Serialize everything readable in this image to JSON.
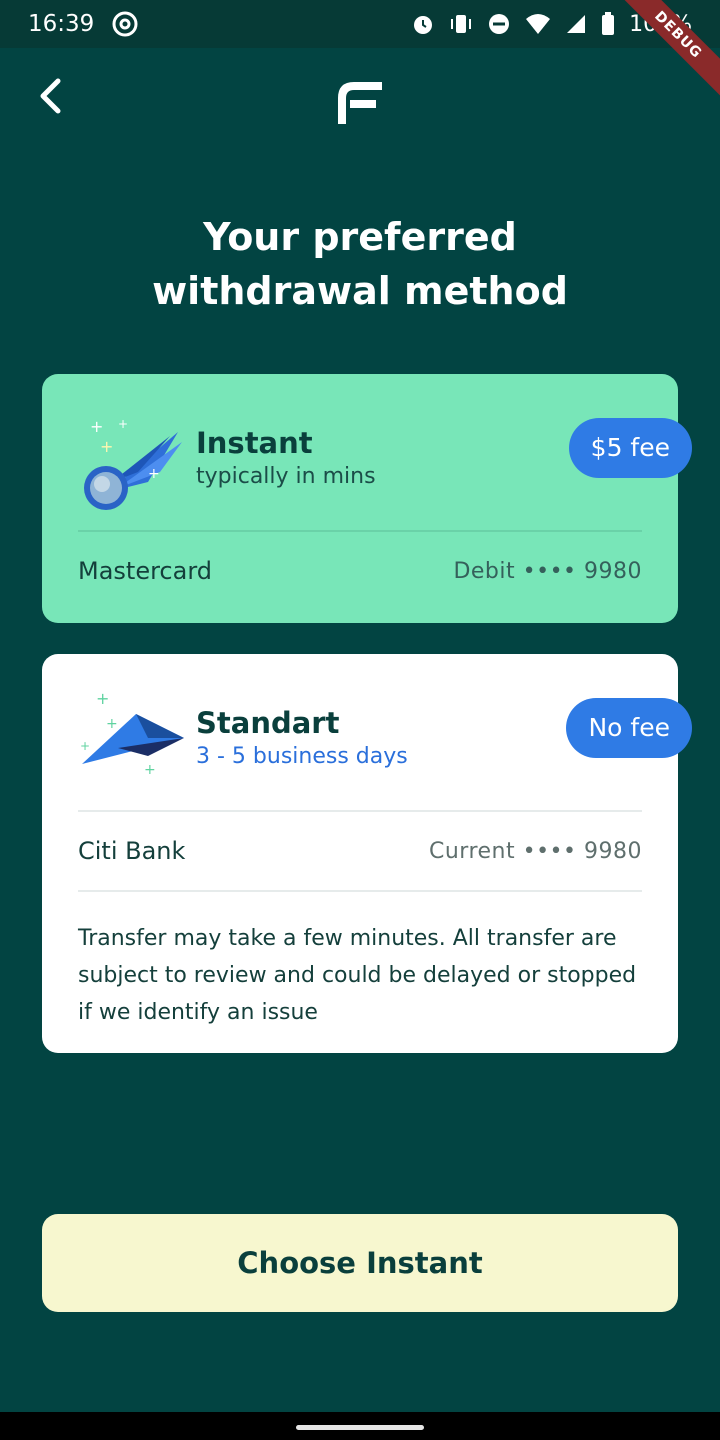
{
  "status_bar": {
    "time": "16:39",
    "battery": "100%",
    "debug_banner": "DEBUG",
    "icons": [
      "at-sign-icon",
      "alarm-icon",
      "vibrate-icon",
      "dnd-icon",
      "wifi-icon",
      "signal-icon",
      "battery-icon"
    ]
  },
  "header": {
    "back_icon": "chevron-left-icon",
    "logo_icon": "f-logo-icon"
  },
  "title": {
    "line1": "Your preferred",
    "line2": "withdrawal method"
  },
  "methods": [
    {
      "name": "Instant",
      "subtitle": "typically in mins",
      "fee": "$5 fee",
      "account_name": "Mastercard",
      "account_detail": "Debit •••• 9980",
      "icon": "meteor-icon",
      "colors": {
        "card": "#78e6b8"
      }
    },
    {
      "name": "Standart",
      "subtitle": "3 - 5 business days",
      "fee": "No fee",
      "account_name": "Citi Bank",
      "account_detail": "Current •••• 9980",
      "icon": "paper-plane-icon",
      "note": "Transfer may take a few minutes. All transfer are subject to review and could be delayed or stopped if we identify an issue",
      "colors": {
        "card": "#ffffff"
      }
    }
  ],
  "cta": {
    "label": "Choose Instant"
  },
  "colors": {
    "background": "#024442",
    "badge": "#2f7be5",
    "cta_bg": "#f7f7cf",
    "accent_text": "#2a6fdb"
  }
}
